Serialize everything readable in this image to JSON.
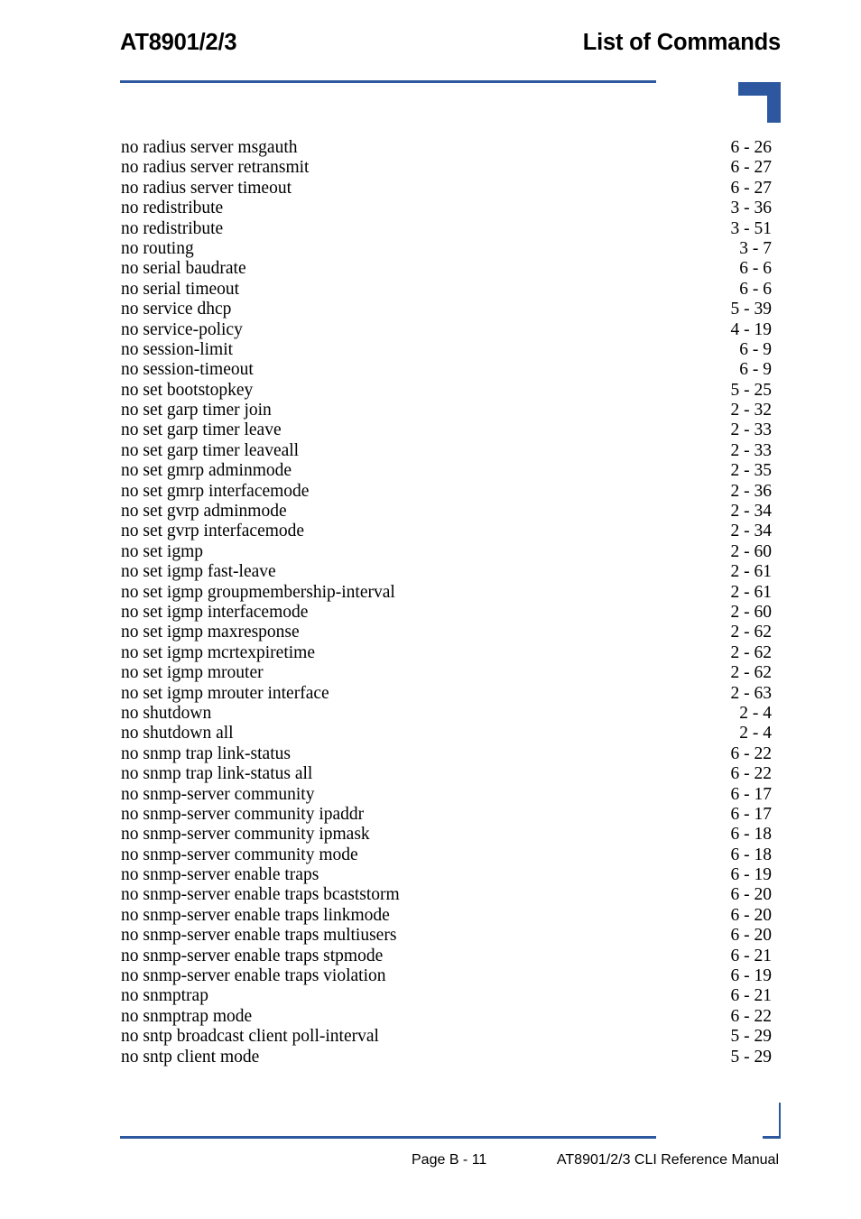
{
  "header": {
    "product": "AT8901/2/3",
    "section_title": "List of Commands"
  },
  "theme": {
    "accent_blue": "#2d589f",
    "text_color": "#000000",
    "background": "#ffffff"
  },
  "index": {
    "entries": [
      {
        "command": "no radius server msgauth",
        "page": "6 - 26"
      },
      {
        "command": "no radius server retransmit",
        "page": "6 - 27"
      },
      {
        "command": "no radius server timeout",
        "page": "6 - 27"
      },
      {
        "command": "no redistribute",
        "page": "3 - 36"
      },
      {
        "command": "no redistribute",
        "page": "3 - 51"
      },
      {
        "command": "no routing",
        "page": "3 - 7"
      },
      {
        "command": "no serial baudrate",
        "page": "6 - 6"
      },
      {
        "command": "no serial timeout",
        "page": "6 - 6"
      },
      {
        "command": "no service dhcp",
        "page": "5 - 39"
      },
      {
        "command": "no service-policy",
        "page": "4 - 19"
      },
      {
        "command": "no session-limit",
        "page": "6 - 9"
      },
      {
        "command": "no session-timeout",
        "page": "6 - 9"
      },
      {
        "command": "no set bootstopkey",
        "page": "5 - 25"
      },
      {
        "command": "no set garp timer join",
        "page": "2 - 32"
      },
      {
        "command": "no set garp timer leave",
        "page": "2 - 33"
      },
      {
        "command": "no set garp timer leaveall",
        "page": "2 - 33"
      },
      {
        "command": "no set gmrp adminmode",
        "page": "2 - 35"
      },
      {
        "command": "no set gmrp interfacemode",
        "page": "2 - 36"
      },
      {
        "command": "no set gvrp adminmode",
        "page": "2 - 34"
      },
      {
        "command": "no set gvrp interfacemode",
        "page": "2 - 34"
      },
      {
        "command": "no set igmp",
        "page": "2 - 60"
      },
      {
        "command": "no set igmp fast-leave",
        "page": "2 - 61"
      },
      {
        "command": "no set igmp groupmembership-interval",
        "page": "2 - 61"
      },
      {
        "command": "no set igmp interfacemode",
        "page": "2 - 60"
      },
      {
        "command": "no set igmp maxresponse",
        "page": "2 - 62"
      },
      {
        "command": "no set igmp mcrtexpiretime",
        "page": "2 - 62"
      },
      {
        "command": "no set igmp mrouter",
        "page": "2 - 62"
      },
      {
        "command": "no set igmp mrouter interface",
        "page": "2 - 63"
      },
      {
        "command": "no shutdown",
        "page": "2 - 4"
      },
      {
        "command": "no shutdown all",
        "page": "2 - 4"
      },
      {
        "command": "no snmp trap link-status",
        "page": "6 - 22"
      },
      {
        "command": "no snmp trap link-status all",
        "page": "6 - 22"
      },
      {
        "command": "no snmp-server community",
        "page": "6 - 17"
      },
      {
        "command": "no snmp-server community ipaddr",
        "page": "6 - 17"
      },
      {
        "command": "no snmp-server community ipmask",
        "page": "6 - 18"
      },
      {
        "command": "no snmp-server community mode",
        "page": "6 - 18"
      },
      {
        "command": "no snmp-server enable traps",
        "page": "6 - 19"
      },
      {
        "command": "no snmp-server enable traps bcaststorm",
        "page": "6 - 20"
      },
      {
        "command": "no snmp-server enable traps linkmode",
        "page": "6 - 20"
      },
      {
        "command": "no snmp-server enable traps multiusers",
        "page": "6 - 20"
      },
      {
        "command": "no snmp-server enable traps stpmode",
        "page": "6 - 21"
      },
      {
        "command": "no snmp-server enable traps violation",
        "page": "6 - 19"
      },
      {
        "command": "no snmptrap",
        "page": "6 - 21"
      },
      {
        "command": "no snmptrap mode",
        "page": "6 - 22"
      },
      {
        "command": "no sntp broadcast client poll-interval",
        "page": "5 - 29"
      },
      {
        "command": "no sntp client mode",
        "page": "5 - 29"
      }
    ]
  },
  "footer": {
    "page_number": "Page B - 11",
    "manual_title": "AT8901/2/3 CLI Reference Manual"
  }
}
